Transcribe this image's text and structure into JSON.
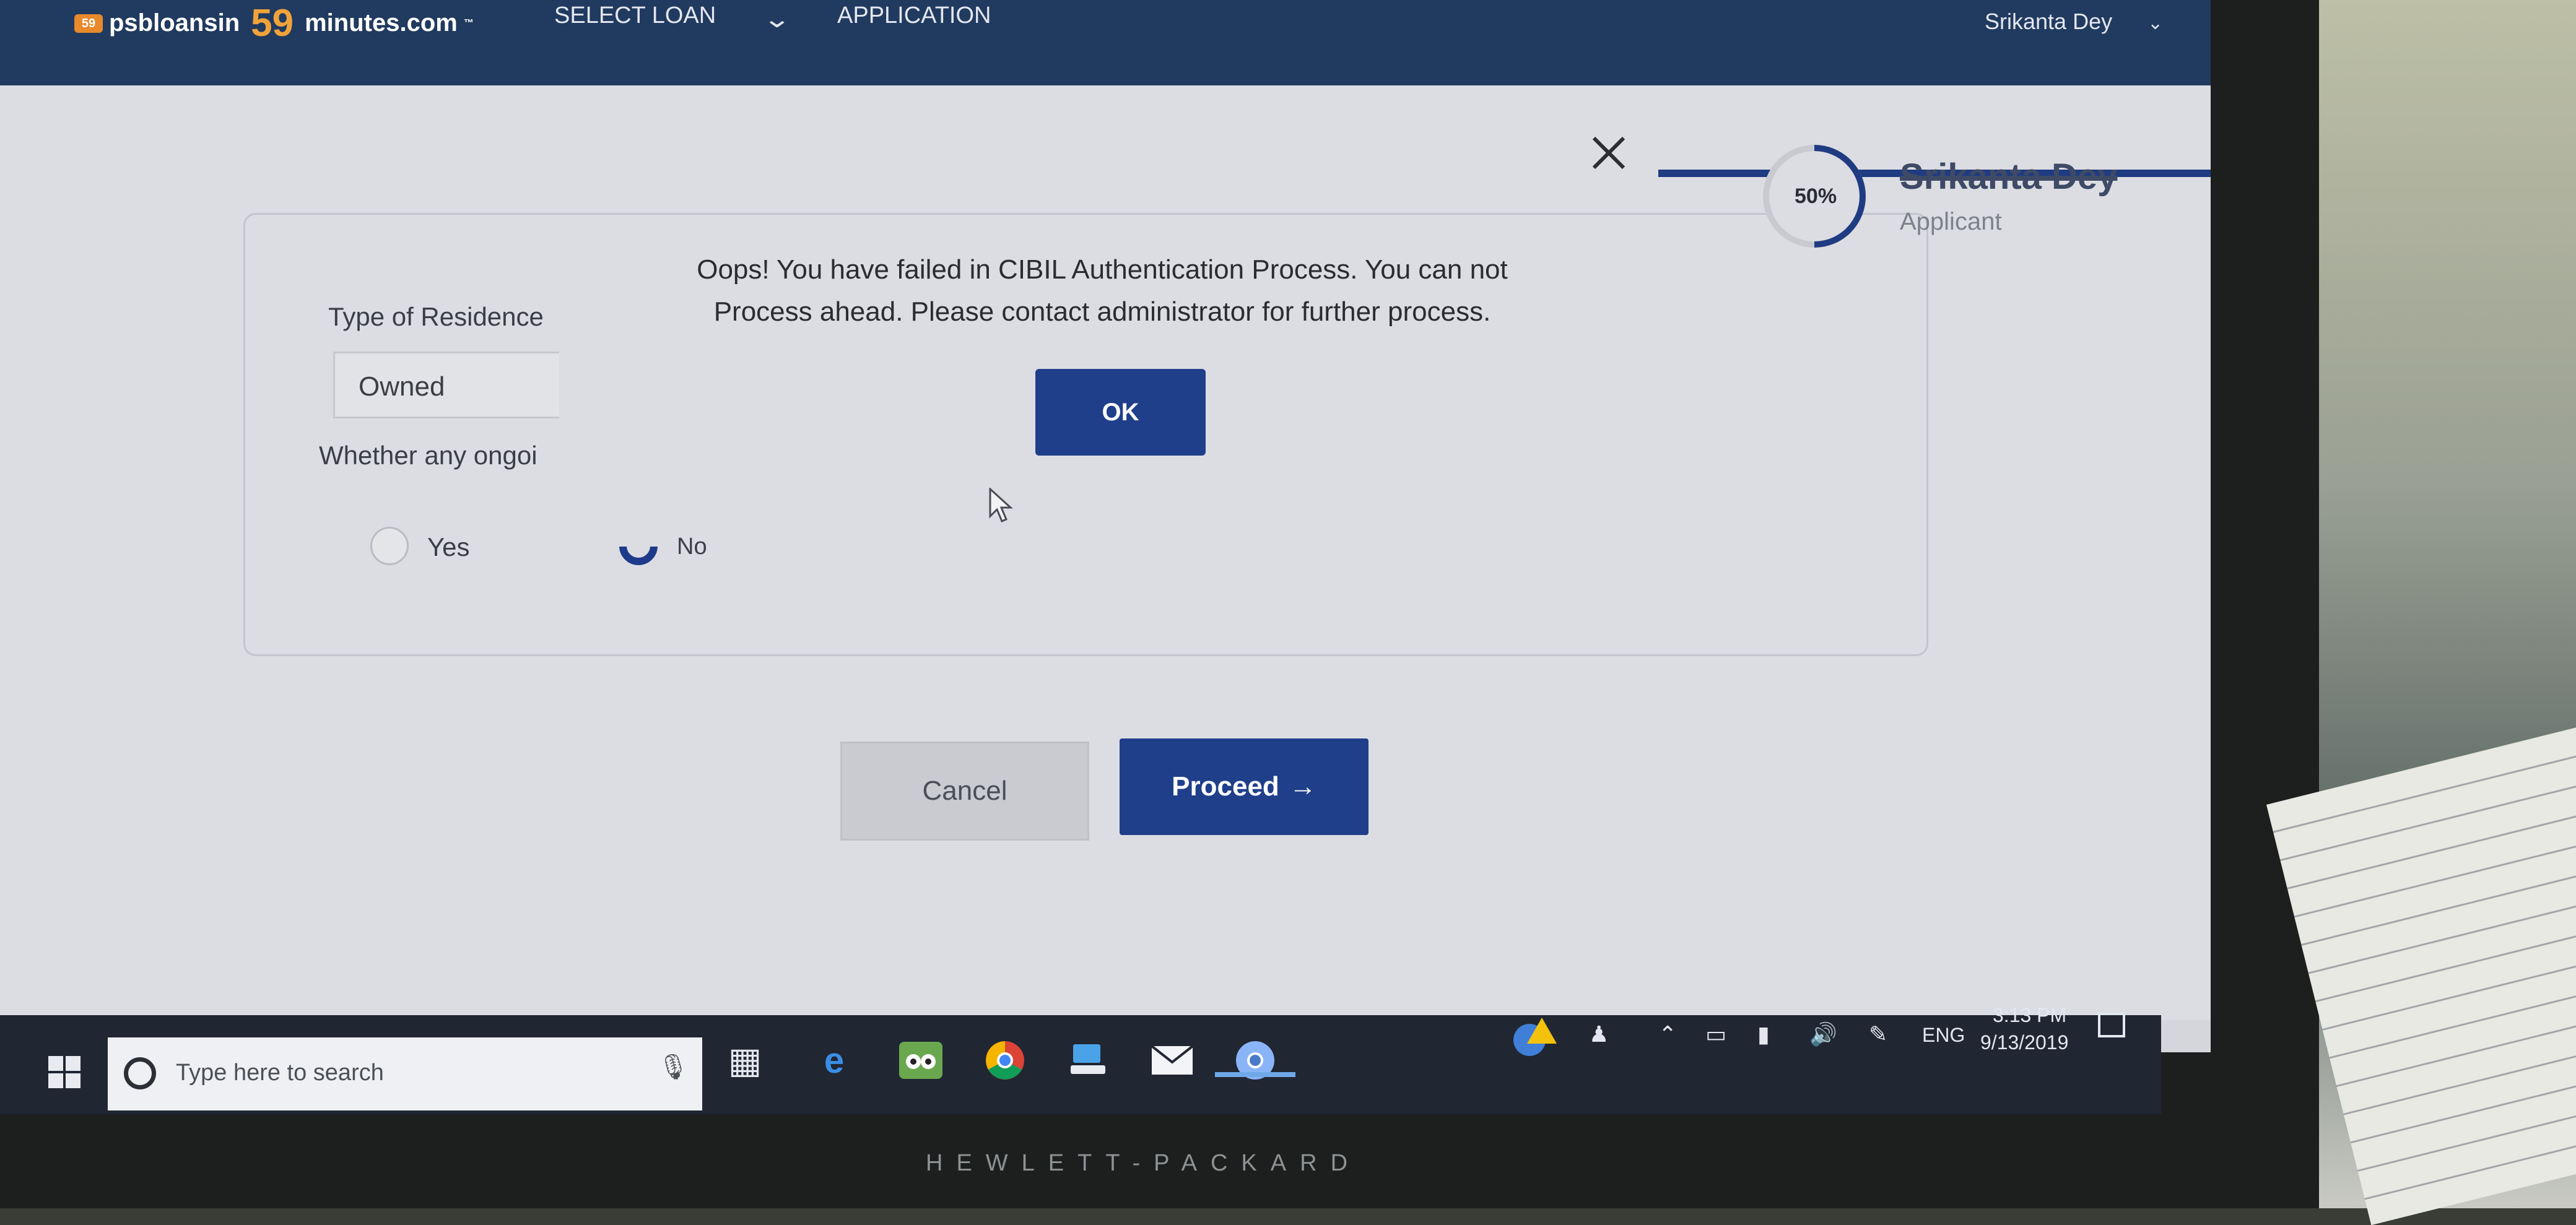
{
  "header": {
    "brand_part1": "psbloansin",
    "brand_number": "59",
    "brand_part2": "minutes.com",
    "brand_tm": "™",
    "brand_mark": "59",
    "nav_select_loan": "SELECT LOAN",
    "nav_application": "APPLICATION",
    "user_name": "Srikanta Dey"
  },
  "progress": {
    "percent_label": "50%",
    "percent_value": 0.5,
    "applicant_name": "Srikanta Dey",
    "applicant_role": "Applicant"
  },
  "form": {
    "residence_label": "Type of Residence",
    "residence_value": "Owned",
    "ongoing_label": "Whether any ongoi",
    "options": [
      "Yes",
      "No"
    ],
    "selected_option": "No"
  },
  "actions": {
    "cancel_label": "Cancel",
    "proceed_label": "Proceed",
    "proceed_arrow": "→"
  },
  "modal": {
    "message_line1": "Oops! You have failed in CIBIL Authentication Process. You can not",
    "message_line2": "Process ahead. Please contact administrator for further process.",
    "ok_label": "OK"
  },
  "taskbar": {
    "search_placeholder": "Type here to search",
    "language": "ENG",
    "time": "3:13 PM",
    "date": "9/13/2019",
    "apps": [
      "task-view-icon",
      "edge-icon",
      "tripadvisor-icon",
      "chrome-icon",
      "file-explorer-icon",
      "mail-icon",
      "chromium-icon"
    ]
  },
  "device": {
    "bezel_brand": "HEWLETT-PACKARD"
  },
  "colors": {
    "nav_bar": "#213a5f",
    "primary_button": "#1f3f8a",
    "brand_orange": "#f0a33a",
    "taskbar": "#202632"
  }
}
